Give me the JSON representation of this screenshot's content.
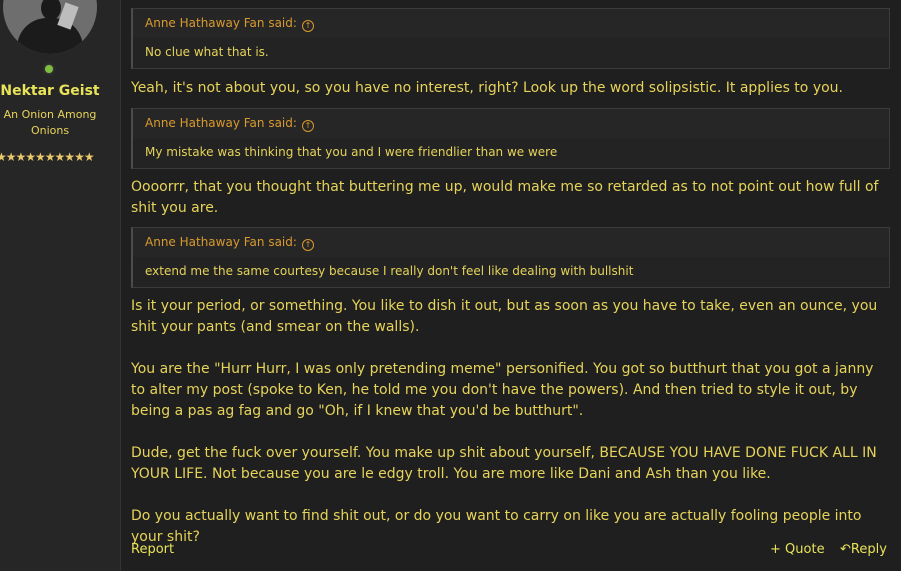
{
  "user": {
    "name": "Nektar Geist",
    "title": "An Onion Among Onions",
    "stars": "★★★★★★★★★★",
    "avatar": "avatar-image"
  },
  "post": {
    "quotes": [
      {
        "author": "Anne Hathaway Fan said:",
        "text": "No clue what that is."
      },
      {
        "author": "Anne Hathaway Fan said:",
        "text": "My mistake was thinking that you and I were friendlier than we were"
      },
      {
        "author": "Anne Hathaway Fan said:",
        "text": "extend me the same courtesy because I really don't feel like dealing with bullshit"
      }
    ],
    "paragraphs": [
      "Yeah, it's not about you, so you have no interest, right? Look up the word solipsistic. It applies to you.",
      "Oooorrr, that you thought that buttering me up, would make me so retarded as to not point out how full of shit you are.",
      "Is it your period, or something. You like to dish it out, but as soon as you have to take, even an ounce, you shit your pants (and smear on the walls).",
      "You are the \"Hurr Hurr, I was only pretending meme\" personified. You got so butthurt that you got a janny to alter my post (spoke to Ken, he told me you don't have the powers). And then tried to style it out, by being a pas ag fag and go \"Oh, if I knew that you'd be butthurt\".",
      "Dude, get the fuck over yourself. You make up shit about yourself, BECAUSE YOU HAVE DONE FUCK ALL IN YOUR LIFE. Not because you are le edgy troll. You are more like Dani and Ash than you like.",
      "Do you actually want to find shit out, or do you want to carry on like you are actually fooling people into your shit?"
    ]
  },
  "actions": {
    "report": "Report",
    "quote": "Quote",
    "reply": "Reply",
    "quote_icon": "+",
    "reply_icon": "↶"
  },
  "colors": {
    "text": "#e6d35a",
    "quote_author": "#d99a2e",
    "background": "#1f1f1f"
  }
}
